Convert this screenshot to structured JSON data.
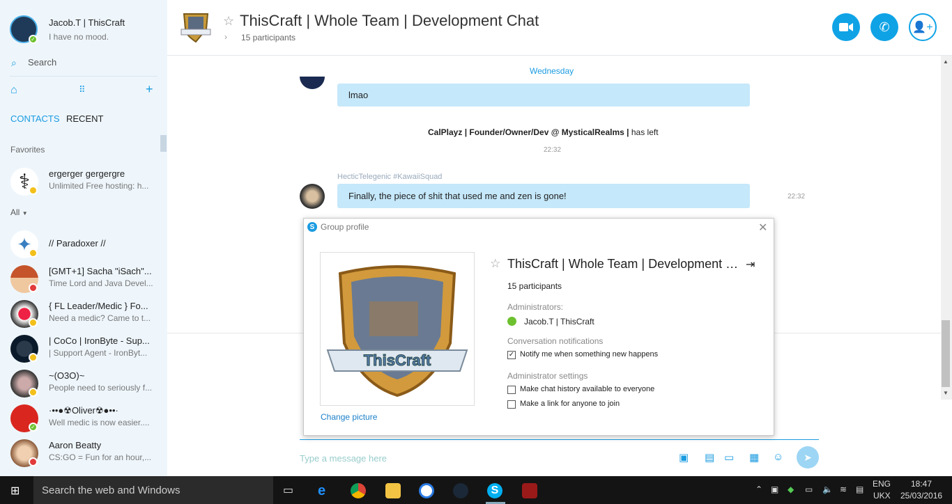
{
  "sidebar": {
    "user_name": "Jacob.T | ThisCraft",
    "user_mood": "I have no mood.",
    "search_placeholder": "Search",
    "tabs": [
      "CONTACTS",
      "RECENT"
    ],
    "favorites_label": "Favorites",
    "favorite": {
      "name": "ergerger gergergre",
      "mood": "Unlimited Free hosting: h..."
    },
    "filter_label": "All",
    "contacts": [
      {
        "name": "// Paradoxer //",
        "mood": ""
      },
      {
        "name": "[GMT+1] Sacha \"iSach\"...",
        "mood": "Time Lord and Java Devel..."
      },
      {
        "name": "{ FL Leader/Medic } Fo...",
        "mood": "Need a medic? Came to t..."
      },
      {
        "name": "| CoCo | IronByte - Sup...",
        "mood": "| Support Agent - IronByt..."
      },
      {
        "name": "~(O3O)~",
        "mood": "People need to seriously f..."
      },
      {
        "name": "·••●☢Oliver☢●••·",
        "mood": "Well medic is now easier...."
      },
      {
        "name": "Aaron Beatty",
        "mood": "CS:GO = Fun for an hour,..."
      }
    ]
  },
  "header": {
    "title": "ThisCraft | Whole Team | Development Chat",
    "participants": "15 participants"
  },
  "chat": {
    "day_label": "Wednesday",
    "msg1": "lmao",
    "system_user": "CalPlayz | Founder/Owner/Dev @ MysticalRealms |",
    "system_action": "has left",
    "system_time": "22:32",
    "sender": "HecticTelegenic #KawaiiSquad",
    "msg2": "Finally, the piece of shit that used me and zen is gone!",
    "msg2_time": "22:32",
    "compose_placeholder": "Type a message here"
  },
  "dialog": {
    "title": "Group profile",
    "group_name": "ThisCraft | Whole Team | Development C...",
    "participants": "15 participants",
    "admins_label": "Administrators:",
    "admin_name": "Jacob.T | ThisCraft",
    "notif_label": "Conversation notifications",
    "notif_option": "Notify me when something new happens",
    "admin_settings_label": "Administrator settings",
    "opt_history": "Make chat history available to everyone",
    "opt_link": "Make a link for anyone to join",
    "change_picture": "Change picture",
    "logo_text": "ThisCraft"
  },
  "taskbar": {
    "search_placeholder": "Search the web and Windows",
    "lang": "ENG",
    "layout": "UKX",
    "time": "18:47",
    "date": "25/03/2016"
  },
  "colors": {
    "accent": "#0fa3e6",
    "bubble": "#c5e8fa",
    "sidebar": "#eef6fc"
  }
}
